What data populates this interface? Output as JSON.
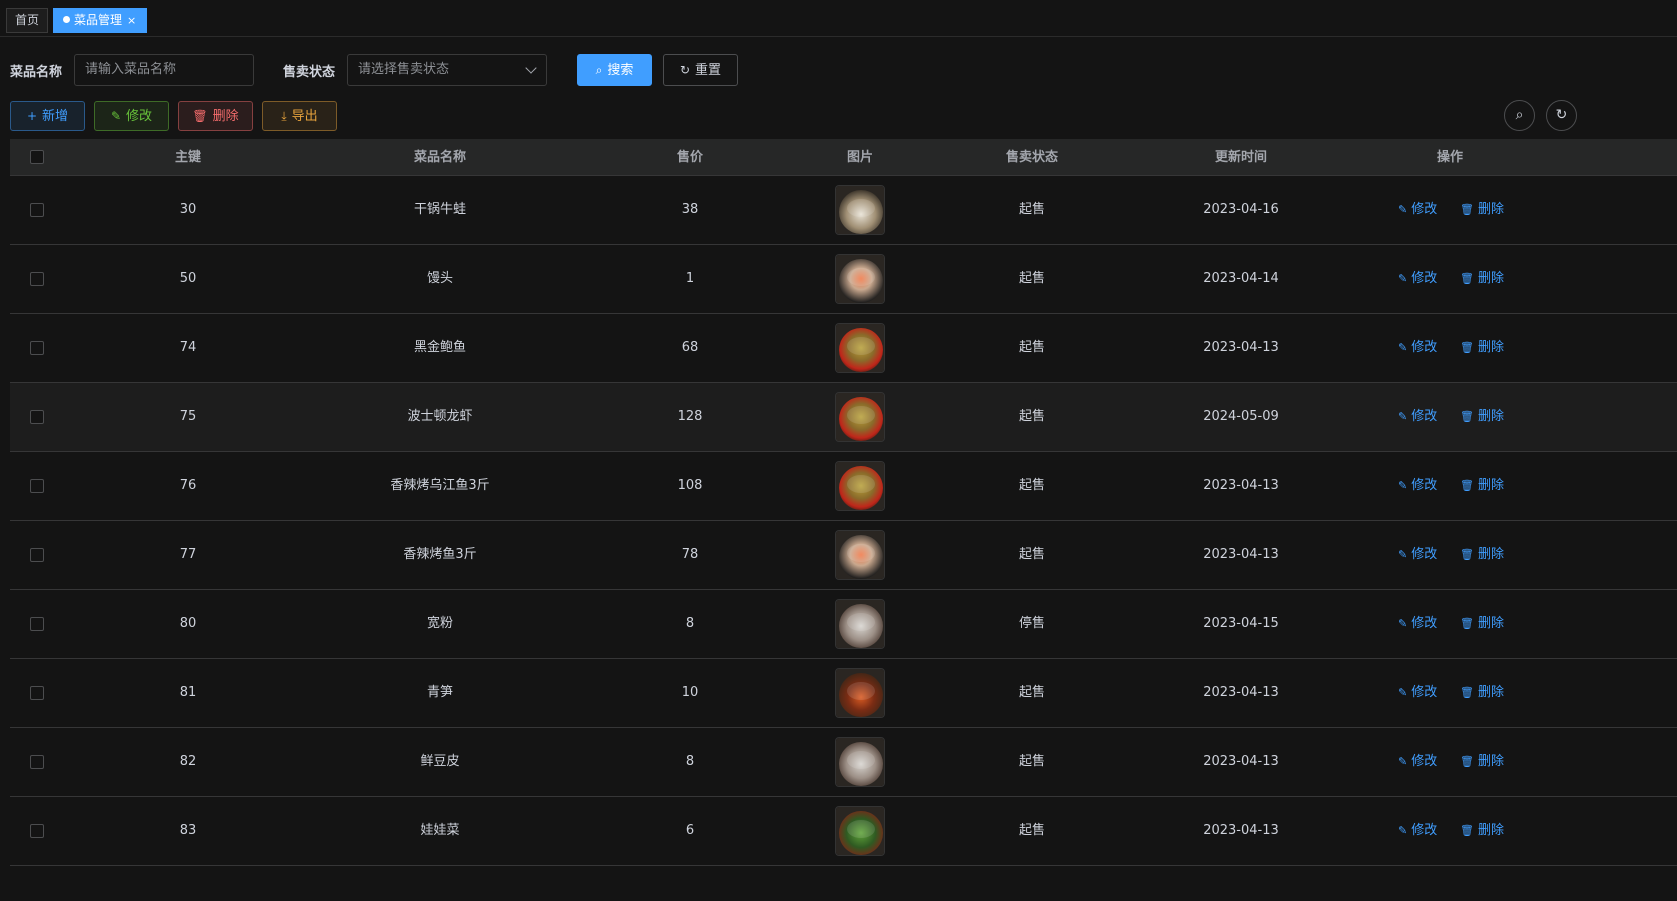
{
  "tags": {
    "home": "首页",
    "active": "菜品管理",
    "close": "×"
  },
  "search": {
    "name_label": "菜品名称",
    "name_placeholder": "请输入菜品名称",
    "status_label": "售卖状态",
    "status_placeholder": "请选择售卖状态",
    "search_btn": "搜索",
    "reset_btn": "重置"
  },
  "toolbar": {
    "add": "新增",
    "edit": "修改",
    "delete": "删除",
    "export": "导出"
  },
  "table": {
    "columns": [
      "主键",
      "菜品名称",
      "售价",
      "图片",
      "售卖状态",
      "更新时间",
      "操作"
    ],
    "action_edit": "修改",
    "action_delete": "删除",
    "rows": [
      {
        "id": "30",
        "name": "干锅牛蛙",
        "price": "38",
        "status": "起售",
        "updated": "2023-04-16",
        "img": "bowl"
      },
      {
        "id": "50",
        "name": "馒头",
        "price": "1",
        "status": "起售",
        "updated": "2023-04-14",
        "img": "hotpot"
      },
      {
        "id": "74",
        "name": "黑金鲍鱼",
        "price": "68",
        "status": "起售",
        "updated": "2023-04-13",
        "img": "spicy"
      },
      {
        "id": "75",
        "name": "波士顿龙虾",
        "price": "128",
        "status": "起售",
        "updated": "2024-05-09",
        "img": "spicy"
      },
      {
        "id": "76",
        "name": "香辣烤乌江鱼3斤",
        "price": "108",
        "status": "起售",
        "updated": "2023-04-13",
        "img": "spicy"
      },
      {
        "id": "77",
        "name": "香辣烤鱼3斤",
        "price": "78",
        "status": "起售",
        "updated": "2023-04-13",
        "img": "hotpot"
      },
      {
        "id": "80",
        "name": "宽粉",
        "price": "8",
        "status": "停售",
        "updated": "2023-04-15",
        "img": "dumpling"
      },
      {
        "id": "81",
        "name": "青笋",
        "price": "10",
        "status": "起售",
        "updated": "2023-04-13",
        "img": "claypot"
      },
      {
        "id": "82",
        "name": "鲜豆皮",
        "price": "8",
        "status": "起售",
        "updated": "2023-04-13",
        "img": "dumpling"
      },
      {
        "id": "83",
        "name": "娃娃菜",
        "price": "6",
        "status": "起售",
        "updated": "2023-04-13",
        "img": "greens"
      }
    ]
  },
  "colors": {
    "primary": "#409eff",
    "success": "#67c23a",
    "danger": "#f56c6c",
    "warning": "#e6a23c"
  }
}
